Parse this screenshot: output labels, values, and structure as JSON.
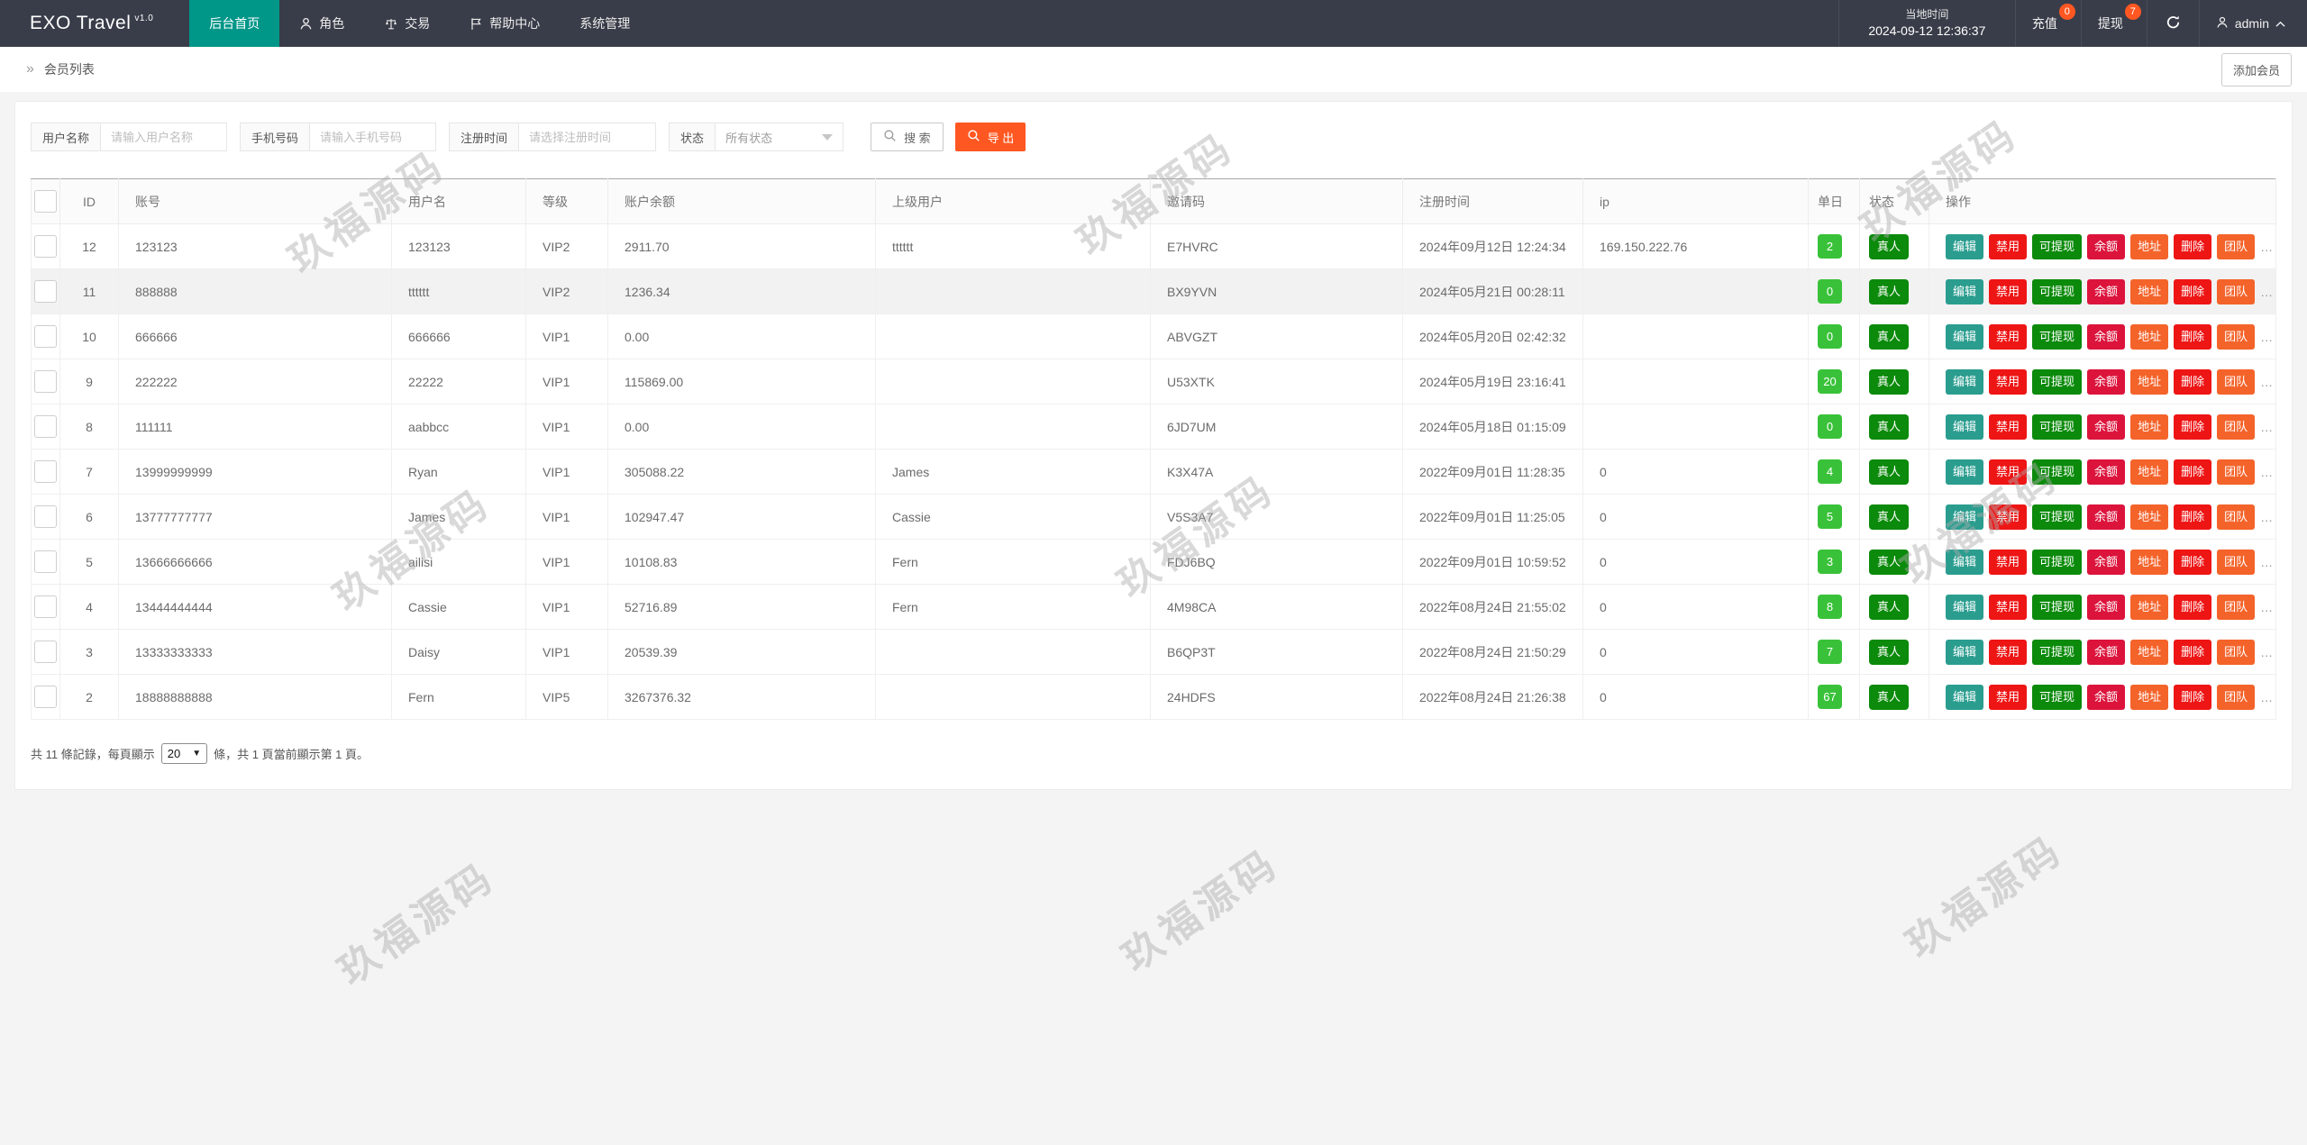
{
  "nav": {
    "logo": "EXO Travel",
    "version": "v1.0",
    "tabs": [
      {
        "label": "后台首页",
        "active": true
      },
      {
        "label": "角色"
      },
      {
        "label": "交易"
      },
      {
        "label": "帮助中心"
      },
      {
        "label": "系统管理"
      }
    ],
    "local_time_label": "当地时间",
    "datetime": "2024-09-12 12:36:37",
    "recharge": {
      "label": "充值",
      "badge": "0"
    },
    "withdraw": {
      "label": "提现",
      "badge": "7"
    },
    "user": "admin"
  },
  "breadcrumb": {
    "icon": "»",
    "title": "会员列表"
  },
  "toolbar": {
    "add_member_label": "添加会员"
  },
  "filters": {
    "username": {
      "label": "用户名称",
      "placeholder": "请输入用户名称"
    },
    "phone": {
      "label": "手机号码",
      "placeholder": "请输入手机号码"
    },
    "reg_time": {
      "label": "注册时间",
      "placeholder": "请选择注册时间"
    },
    "status": {
      "label": "状态",
      "value": "所有状态"
    },
    "search_label": "搜 索",
    "export_label": "导 出"
  },
  "table": {
    "headers": [
      "ID",
      "账号",
      "用户名",
      "等级",
      "账户余额",
      "上级用户",
      "邀请码",
      "注册时间",
      "ip",
      "单日",
      "状态",
      "操作"
    ],
    "rows": [
      {
        "id": "12",
        "account": "123123",
        "username": "123123",
        "level": "VIP2",
        "balance": "2911.70",
        "parent": "tttttt",
        "invite_code": "E7HVRC",
        "reg_time": "2024年09月12日 12:24:34",
        "ip": "169.150.222.76",
        "daily": "2",
        "status": "真人"
      },
      {
        "id": "11",
        "account": "888888",
        "username": "tttttt",
        "level": "VIP2",
        "balance": "1236.34",
        "parent": "",
        "invite_code": "BX9YVN",
        "reg_time": "2024年05月21日 00:28:11",
        "ip": "",
        "daily": "0",
        "status": "真人",
        "highlight": true
      },
      {
        "id": "10",
        "account": "666666",
        "username": "666666",
        "level": "VIP1",
        "balance": "0.00",
        "parent": "",
        "invite_code": "ABVGZT",
        "reg_time": "2024年05月20日 02:42:32",
        "ip": "",
        "daily": "0",
        "status": "真人"
      },
      {
        "id": "9",
        "account": "222222",
        "username": "22222",
        "level": "VIP1",
        "balance": "115869.00",
        "parent": "",
        "invite_code": "U53XTK",
        "reg_time": "2024年05月19日 23:16:41",
        "ip": "",
        "daily": "20",
        "status": "真人"
      },
      {
        "id": "8",
        "account": "111111",
        "username": "aabbcc",
        "level": "VIP1",
        "balance": "0.00",
        "parent": "",
        "invite_code": "6JD7UM",
        "reg_time": "2024年05月18日 01:15:09",
        "ip": "",
        "daily": "0",
        "status": "真人"
      },
      {
        "id": "7",
        "account": "13999999999",
        "username": "Ryan",
        "level": "VIP1",
        "balance": "305088.22",
        "parent": "James",
        "invite_code": "K3X47A",
        "reg_time": "2022年09月01日 11:28:35",
        "ip": "0",
        "daily": "4",
        "status": "真人"
      },
      {
        "id": "6",
        "account": "13777777777",
        "username": "James",
        "level": "VIP1",
        "balance": "102947.47",
        "parent": "Cassie",
        "invite_code": "V5S3A7",
        "reg_time": "2022年09月01日 11:25:05",
        "ip": "0",
        "daily": "5",
        "status": "真人"
      },
      {
        "id": "5",
        "account": "13666666666",
        "username": "ailisi",
        "level": "VIP1",
        "balance": "10108.83",
        "parent": "Fern",
        "invite_code": "FDJ6BQ",
        "reg_time": "2022年09月01日 10:59:52",
        "ip": "0",
        "daily": "3",
        "status": "真人"
      },
      {
        "id": "4",
        "account": "13444444444",
        "username": "Cassie",
        "level": "VIP1",
        "balance": "52716.89",
        "parent": "Fern",
        "invite_code": "4M98CA",
        "reg_time": "2022年08月24日 21:55:02",
        "ip": "0",
        "daily": "8",
        "status": "真人"
      },
      {
        "id": "3",
        "account": "13333333333",
        "username": "Daisy",
        "level": "VIP1",
        "balance": "20539.39",
        "parent": "",
        "invite_code": "B6QP3T",
        "reg_time": "2022年08月24日 21:50:29",
        "ip": "0",
        "daily": "7",
        "status": "真人"
      },
      {
        "id": "2",
        "account": "18888888888",
        "username": "Fern",
        "level": "VIP5",
        "balance": "3267376.32",
        "parent": "",
        "invite_code": "24HDFS",
        "reg_time": "2022年08月24日 21:26:38",
        "ip": "0",
        "daily": "67",
        "status": "真人"
      }
    ],
    "row_actions": [
      {
        "name": "edit",
        "label": "编辑",
        "type": "teal"
      },
      {
        "name": "disable",
        "label": "禁用",
        "type": "red"
      },
      {
        "name": "withdrawable",
        "label": "可提现",
        "type": "green"
      },
      {
        "name": "balance",
        "label": "余额",
        "type": "crimson"
      },
      {
        "name": "address",
        "label": "地址",
        "type": "orange"
      },
      {
        "name": "delete",
        "label": "删除",
        "type": "red"
      },
      {
        "name": "team",
        "label": "团队",
        "type": "orange"
      }
    ],
    "more_label": "…"
  },
  "pagination": {
    "prefix": "共 11 條記錄，每頁顯示",
    "page_size": "20",
    "suffix": "條，共 1 頁當前顯示第 1 頁。"
  },
  "watermark": {
    "text": "玖福源码"
  },
  "colors": {
    "nav_bg": "#393D49",
    "accent_teal": "#009688",
    "export_orange": "#FF5722",
    "nav_badge_orange": "#FF5722",
    "daily_badge_green": "#39c239",
    "status_badge_green": "#0b8a0b",
    "btn_teal": "#2a9d8f",
    "btn_red": "#ee1515",
    "btn_green": "#0b8a0b",
    "btn_crimson": "#dc143c",
    "btn_orange": "#f4632a"
  }
}
